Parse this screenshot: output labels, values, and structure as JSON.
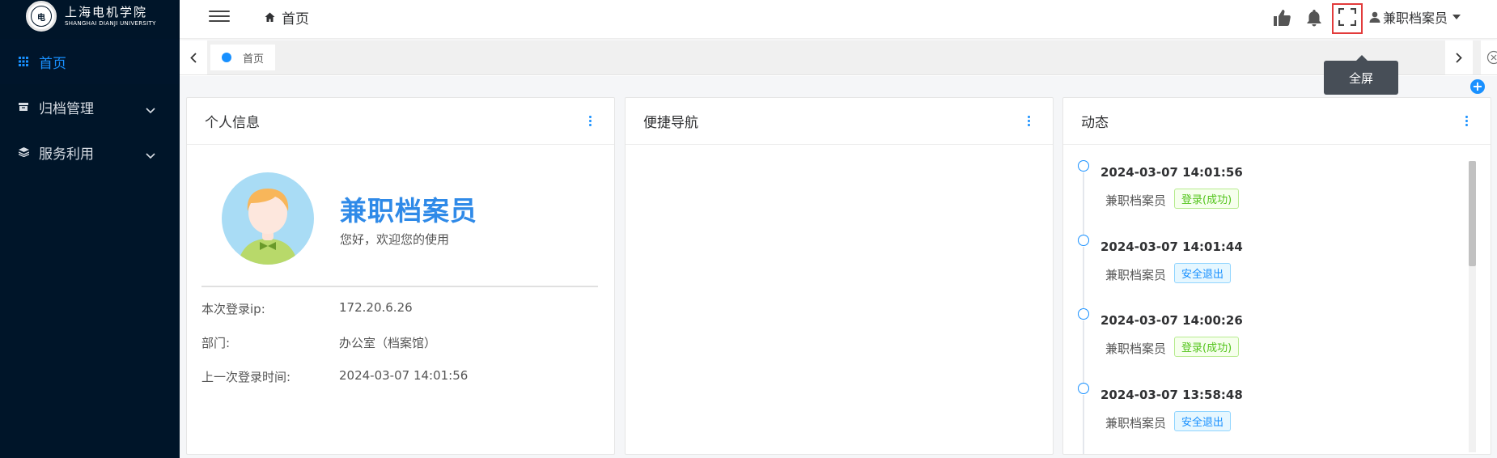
{
  "logo": {
    "cn": "上海电机学院",
    "en": "SHANGHAI DIANJI UNIVERSITY"
  },
  "sidebar": {
    "items": [
      {
        "label": "首页",
        "icon": "grid-icon",
        "active": true
      },
      {
        "label": "归档管理",
        "icon": "archive-icon",
        "active": false
      },
      {
        "label": "服务利用",
        "icon": "layers-icon",
        "active": false
      }
    ]
  },
  "header": {
    "breadcrumb": "首页",
    "user_name": "兼职档案员",
    "tooltip": "全屏"
  },
  "tabs": [
    {
      "label": "首页"
    }
  ],
  "cards": {
    "profile": {
      "title": "个人信息",
      "name": "兼职档案员",
      "greeting": "您好，欢迎您的使用",
      "rows": [
        {
          "label": "本次登录ip:",
          "value": "172.20.6.26"
        },
        {
          "label": "部门:",
          "value": "办公室（档案馆）"
        },
        {
          "label": "上一次登录时间:",
          "value": "2024-03-07 14:01:56"
        }
      ]
    },
    "nav": {
      "title": "便捷导航"
    },
    "activity": {
      "title": "动态",
      "items": [
        {
          "time": "2024-03-07 14:01:56",
          "user": "兼职档案员",
          "tag": "登录(成功)",
          "type": "ok"
        },
        {
          "time": "2024-03-07 14:01:44",
          "user": "兼职档案员",
          "tag": "安全退出",
          "type": "out"
        },
        {
          "time": "2024-03-07 14:00:26",
          "user": "兼职档案员",
          "tag": "登录(成功)",
          "type": "ok"
        },
        {
          "time": "2024-03-07 13:58:48",
          "user": "兼职档案员",
          "tag": "安全退出",
          "type": "out"
        }
      ]
    }
  },
  "colors": {
    "sidebar_bg": "#001529",
    "accent": "#1890ff",
    "success": "#52c41a",
    "highlight_box": "#e23b3b"
  }
}
